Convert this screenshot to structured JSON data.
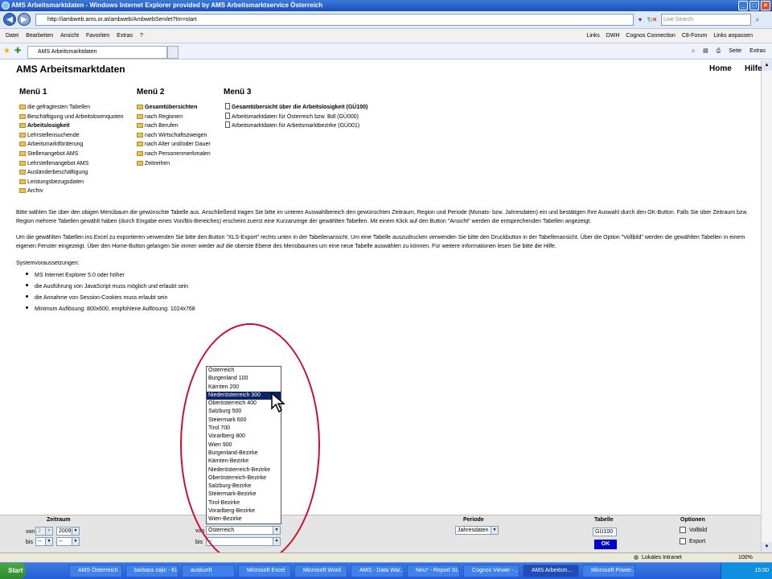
{
  "window": {
    "title": "AMS Arbeitsmarktdaten - Windows Internet Explorer provided by AMS Arbeitsmarktservice Österreich"
  },
  "browser": {
    "url": "http://iambweb.ams.or.at/ambweb/AmbwebServlet?trn=start",
    "search_placeholder": "Live Search",
    "menu": [
      "Datei",
      "Bearbeiten",
      "Ansicht",
      "Favoriten",
      "Extras",
      "?"
    ],
    "links_bar": [
      "Links",
      "DWH",
      "Cognos Connection",
      "C8-Forum",
      "Links anpassen"
    ],
    "tab_label": "AMS Arbeitsmarktdaten",
    "cmd": {
      "page": "Seite",
      "extras": "Extras"
    }
  },
  "app": {
    "title": "AMS Arbeitsmarktdaten",
    "home": "Home",
    "help": "Hilfe"
  },
  "menu1": {
    "title": "Menü 1",
    "items": [
      "die gefragtesten Tabellen",
      "Beschäftigung und Arbeitslosenquoten",
      "Arbeitslosigkeit",
      "Lehrstellensuchende",
      "Arbeitsmarktförderung",
      "Stellenangebot AMS",
      "Lehrstellenangebot AMS",
      "Ausländerbeschäftigung",
      "Leistungsbezugsdaten",
      "Archiv"
    ]
  },
  "menu2": {
    "title": "Menü 2",
    "items": [
      "Gesamtübersichten",
      "nach Regionen",
      "nach Berufen",
      "nach Wirtschaftszweigen",
      "nach Alter und/oder Dauer",
      "nach Personenmerkmalen",
      "Zeitreihen"
    ]
  },
  "menu3": {
    "title": "Menü 3",
    "items": [
      "Gesamtübersicht über die Arbeitslosigkeit (GÜ100)",
      "Arbeitsmarktdaten für Österreich bzw. Bdl (GÜ000)",
      "Arbeitsmarktdaten für Arbeitsmarktbezirke (GÜ001)"
    ]
  },
  "text": {
    "p1": "Bitte wählen Sie über den obigen Menübaum die gewünschte Tabelle aus. Anschließend tragen Sie bitte im unteren Auswahlbereich den gewünschten Zeitraum, Region und Periode (Monats- bzw. Jahresdaten) ein und bestätigen Ihre Auswahl durch den OK-Button. Falls Sie über Zeitraum bzw. Region mehrere Tabellen gewählt haben (durch Eingabe eines Von/Bis-Bereiches) erscheint zuerst eine Kurzanzeige der gewählten Tabellen. Mit einem Klick auf den Button \"Ansicht\" werden die entsprechenden Tabellen angezeigt.",
    "p2": "Um die gewählten Tabellen ins Excel zu exportieren verwenden Sie bitte den Button \"XLS-Export\" rechts unten in der Tabellenansicht. Um eine Tabelle auszudrucken verwenden Sie bitte den Druckbutton in der Tabellenansicht. Über die Option \"Vollbild\" werden die gewählten Tabellen in einem eigenen Fenster eingezeigt. Über den Home-Button gelangen Sie immer wieder auf die oberste Ebene des Menübaumes um eine neue Tabelle auswählen zu können. Für weitere Informationen lesen Sie bitte die Hilfe.",
    "sys_label": "Systemvoraussetzungen:",
    "bullets": [
      "MS Internet Explorer 5.0 oder höher",
      "die Ausführung von JavaScript muss möglich und erlaubt sein",
      "die Annahme von Session-Cookies muss erlaubt sein",
      "Minimum Auflösung: 800x600, empfohlene Auflösung: 1024x768"
    ]
  },
  "region_list": {
    "options": [
      "Österreich",
      "Burgenland 100",
      "Kärnten 200",
      "Niederösterreich 300",
      "Oberösterreich 400",
      "Salzburg 500",
      "Steiermark 600",
      "Tirol 700",
      "Vorarlberg 800",
      "Wien 900",
      "Burgenland-Bezirke",
      "Kärnten-Bezirke",
      "Niederösterreich-Bezirke",
      "Oberösterreich-Bezirke",
      "Salzburg-Bezirke",
      "Steiermark-Bezirke",
      "Tirol-Bezirke",
      "Vorarlberg-Bezirke",
      "Wien-Bezirke"
    ],
    "highlighted": "Niederösterreich 300"
  },
  "form": {
    "zeitraum_label": "Zeitraum",
    "von": "von",
    "bis": "bis",
    "von_month": "2",
    "von_year": "2009",
    "bis_month": "--",
    "bis_year": "--",
    "region_von": "Österreich",
    "region_bis": "--",
    "periode_label": "Periode",
    "periode_value": "Jahresdaten",
    "tabelle_label": "Tabelle",
    "tabelle_value": "GÜ100",
    "ok": "OK",
    "optionen_label": "Optionen",
    "vollbild": "Vollbild",
    "export": "Export"
  },
  "status": {
    "zone": "Lokales Intranet",
    "zoom": "100%"
  },
  "taskbar": {
    "start": "Start",
    "tasks": [
      "AMS Österreich ...",
      "barbara zajic - Ei...",
      "auskunft",
      "Microsoft Excel",
      "Microsoft Word",
      "AMS - Data War...",
      "Neu* - Report St...",
      "Cognos Viewer - ...",
      "AMS Arbeitsm...",
      "Microsoft Power..."
    ],
    "clock": "15:00"
  }
}
